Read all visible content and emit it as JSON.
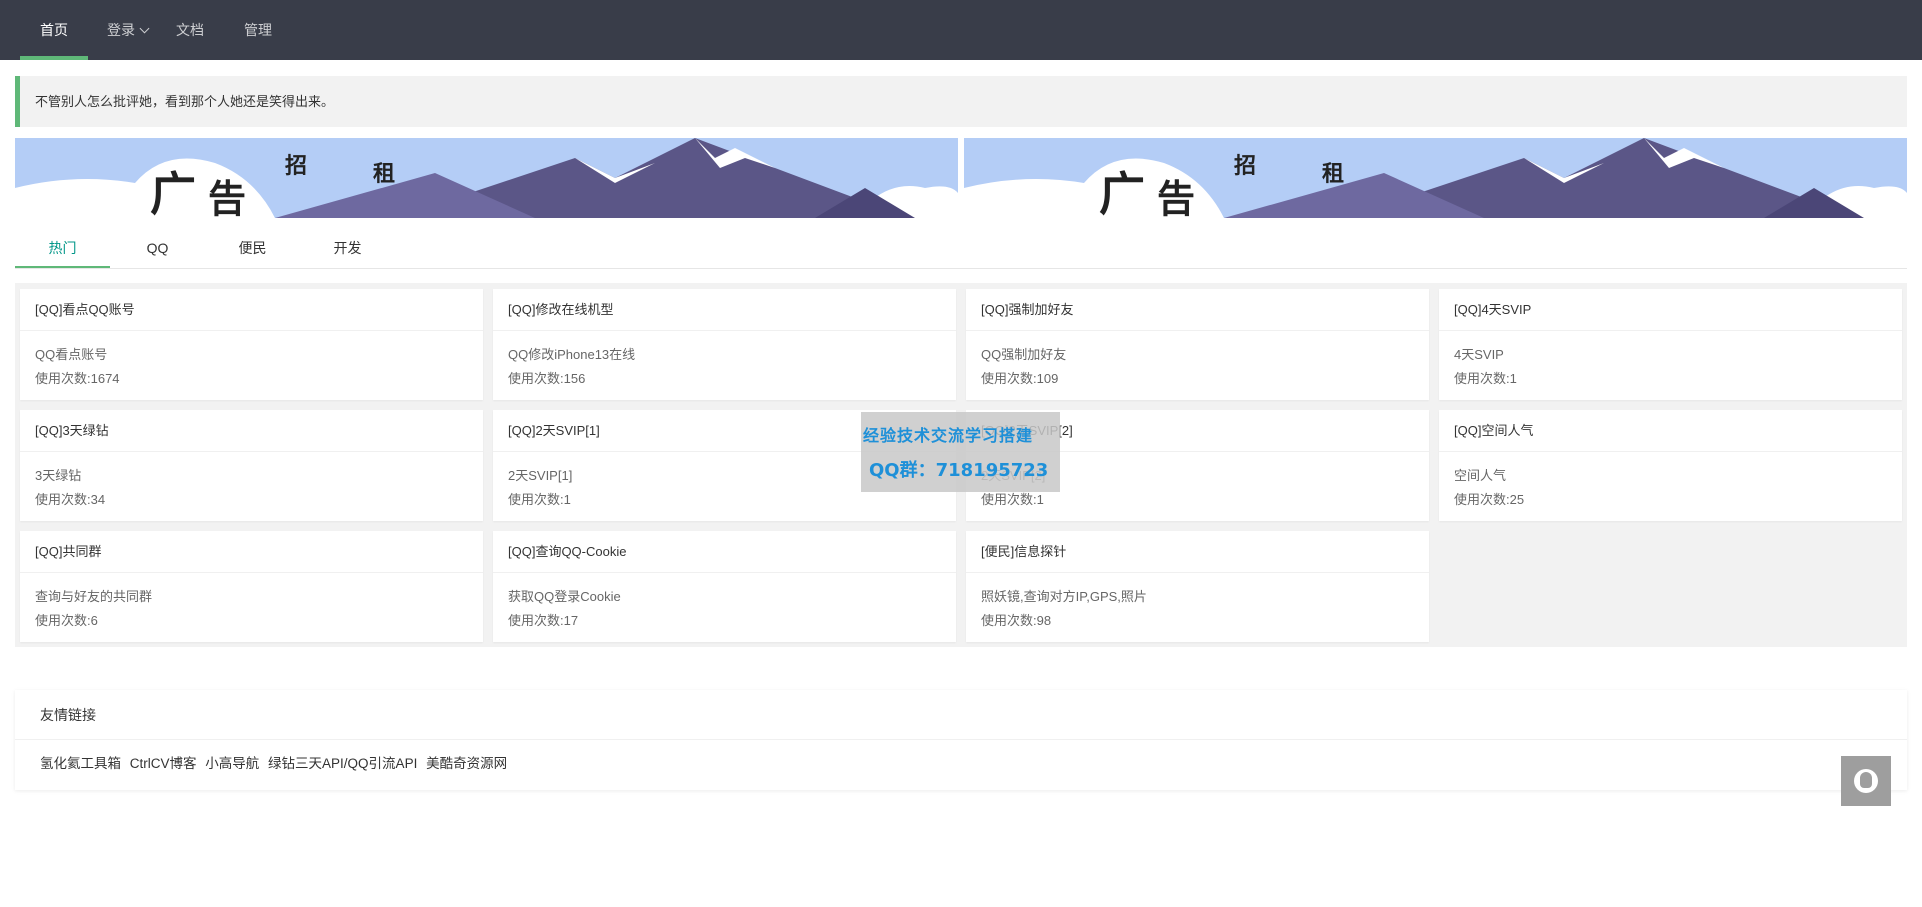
{
  "nav": {
    "items": [
      {
        "label": "首页",
        "active": true
      },
      {
        "label": "登录",
        "has_dropdown": true
      },
      {
        "label": "文档"
      },
      {
        "label": "管理"
      }
    ]
  },
  "notice": {
    "text": "不管别人怎么批评她，看到那个人她还是笑得出来。"
  },
  "banners": [
    {
      "text": [
        "广",
        "告",
        "招",
        "租"
      ]
    },
    {
      "text": [
        "广",
        "告",
        "招",
        "租"
      ]
    }
  ],
  "tabs": [
    {
      "label": "热门",
      "active": true
    },
    {
      "label": "QQ"
    },
    {
      "label": "便民"
    },
    {
      "label": "开发"
    }
  ],
  "cards": [
    {
      "title": "[QQ]看点QQ账号",
      "desc": "QQ看点账号",
      "usage": "使用次数:1674"
    },
    {
      "title": "[QQ]修改在线机型",
      "desc": "QQ修改iPhone13在线",
      "usage": "使用次数:156"
    },
    {
      "title": "[QQ]强制加好友",
      "desc": "QQ强制加好友",
      "usage": "使用次数:109"
    },
    {
      "title": "[QQ]4天SVIP",
      "desc": "4天SVIP",
      "usage": "使用次数:1"
    },
    {
      "title": "[QQ]3天绿钻",
      "desc": "3天绿钻",
      "usage": "使用次数:34"
    },
    {
      "title": "[QQ]2天SVIP[1]",
      "desc": "2天SVIP[1]",
      "usage": "使用次数:1"
    },
    {
      "title": "[QQ]2天SVIP[2]",
      "desc": "2天SVIP[2]",
      "usage": "使用次数:1"
    },
    {
      "title": "[QQ]空间人气",
      "desc": "空间人气",
      "usage": "使用次数:25"
    },
    {
      "title": "[QQ]共同群",
      "desc": "查询与好友的共同群",
      "usage": "使用次数:6"
    },
    {
      "title": "[QQ]查询QQ-Cookie",
      "desc": "获取QQ登录Cookie",
      "usage": "使用次数:17"
    },
    {
      "title": "[便民]信息探针",
      "desc": "照妖镜,查询对方IP,GPS,照片",
      "usage": "使用次数:98"
    }
  ],
  "watermark": {
    "line1": "经验技术交流学习搭建",
    "line2": "QQ群：718195723"
  },
  "links": {
    "title": "友情链接",
    "items": [
      "氢化氦工具箱",
      "CtrlCV博客",
      "小高导航",
      "绿钻三天API/QQ引流API",
      "美酷奇资源网"
    ]
  },
  "float": {
    "icon": "qq-penguin-icon"
  },
  "colors": {
    "nav_bg": "#393d49",
    "accent": "#5fb878",
    "tab_active_text": "#009688",
    "watermark_text": "#1e90d8"
  }
}
